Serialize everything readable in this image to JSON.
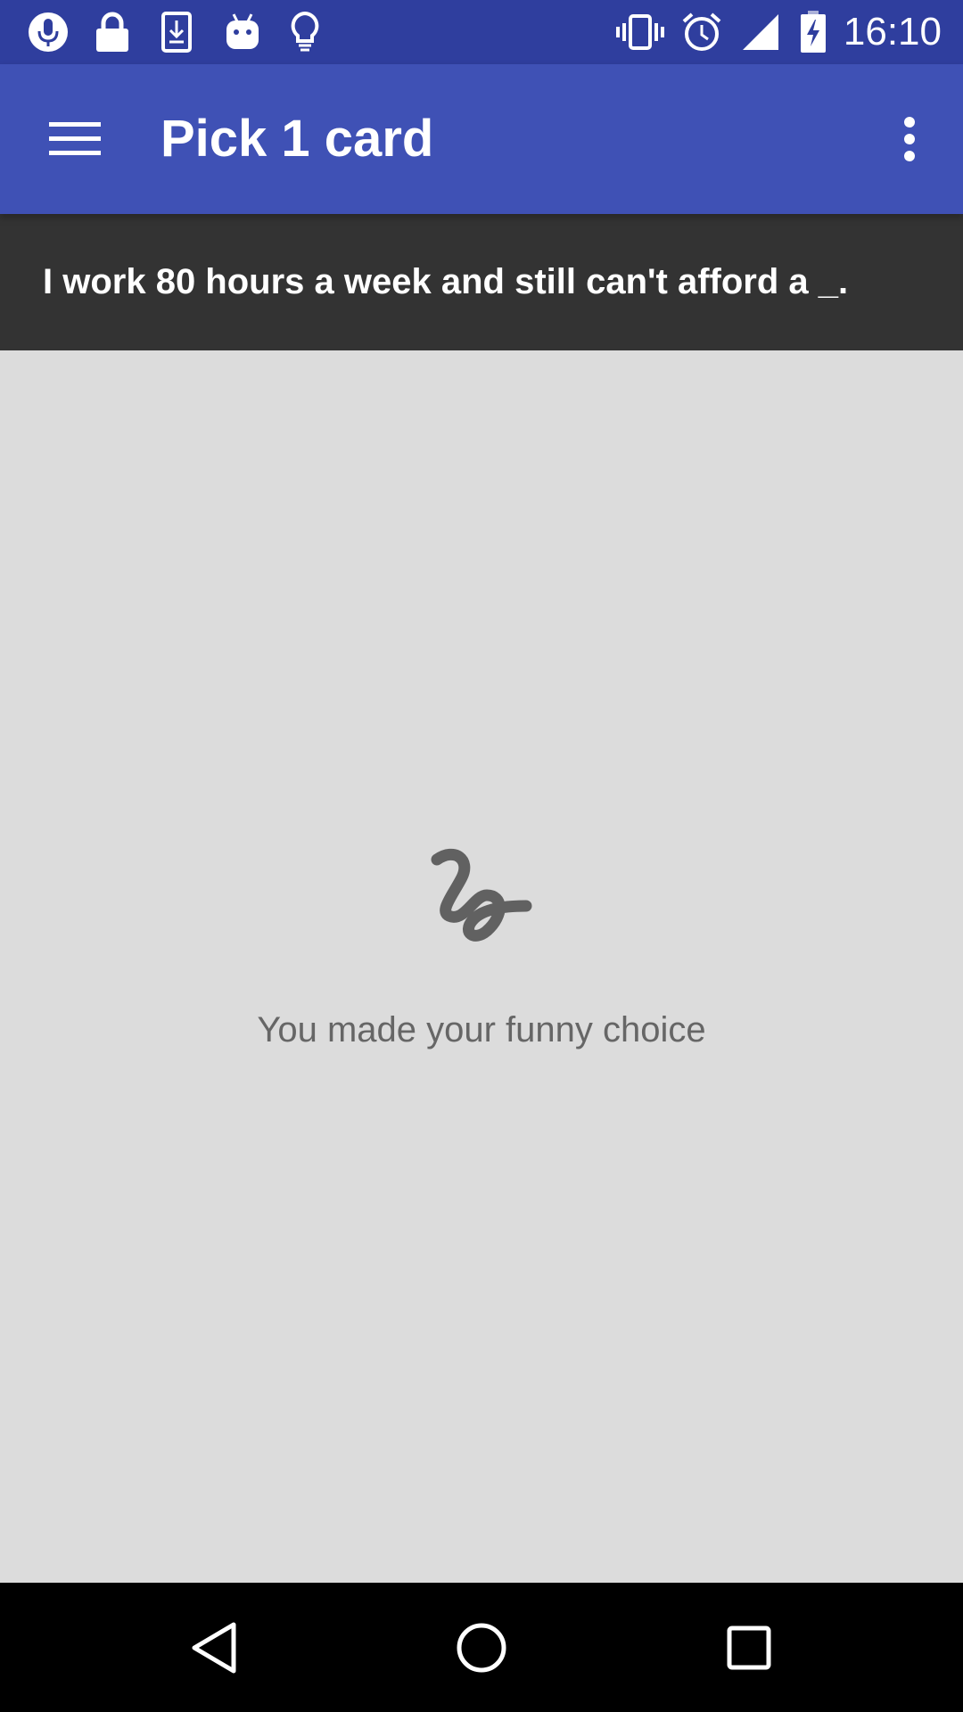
{
  "status_bar": {
    "time": "16:10",
    "left_icons": [
      "microphone-icon",
      "lock-icon",
      "download-icon",
      "android-icon",
      "lightbulb-icon"
    ],
    "right_icons": [
      "vibrate-icon",
      "alarm-icon",
      "signal-icon",
      "battery-charging-icon"
    ],
    "background": "#2f3e9e"
  },
  "app_bar": {
    "title": "Pick 1 card",
    "background": "#3f51b5"
  },
  "question_card": {
    "text": "I work 80 hours a week and still can't afford a _.",
    "background": "#333333"
  },
  "empty_state": {
    "icon": "squiggle-icon",
    "message": "You made your funny choice",
    "text_color": "#666666"
  },
  "nav_bar": {
    "buttons": [
      "back-icon",
      "home-icon",
      "recents-icon"
    ]
  }
}
